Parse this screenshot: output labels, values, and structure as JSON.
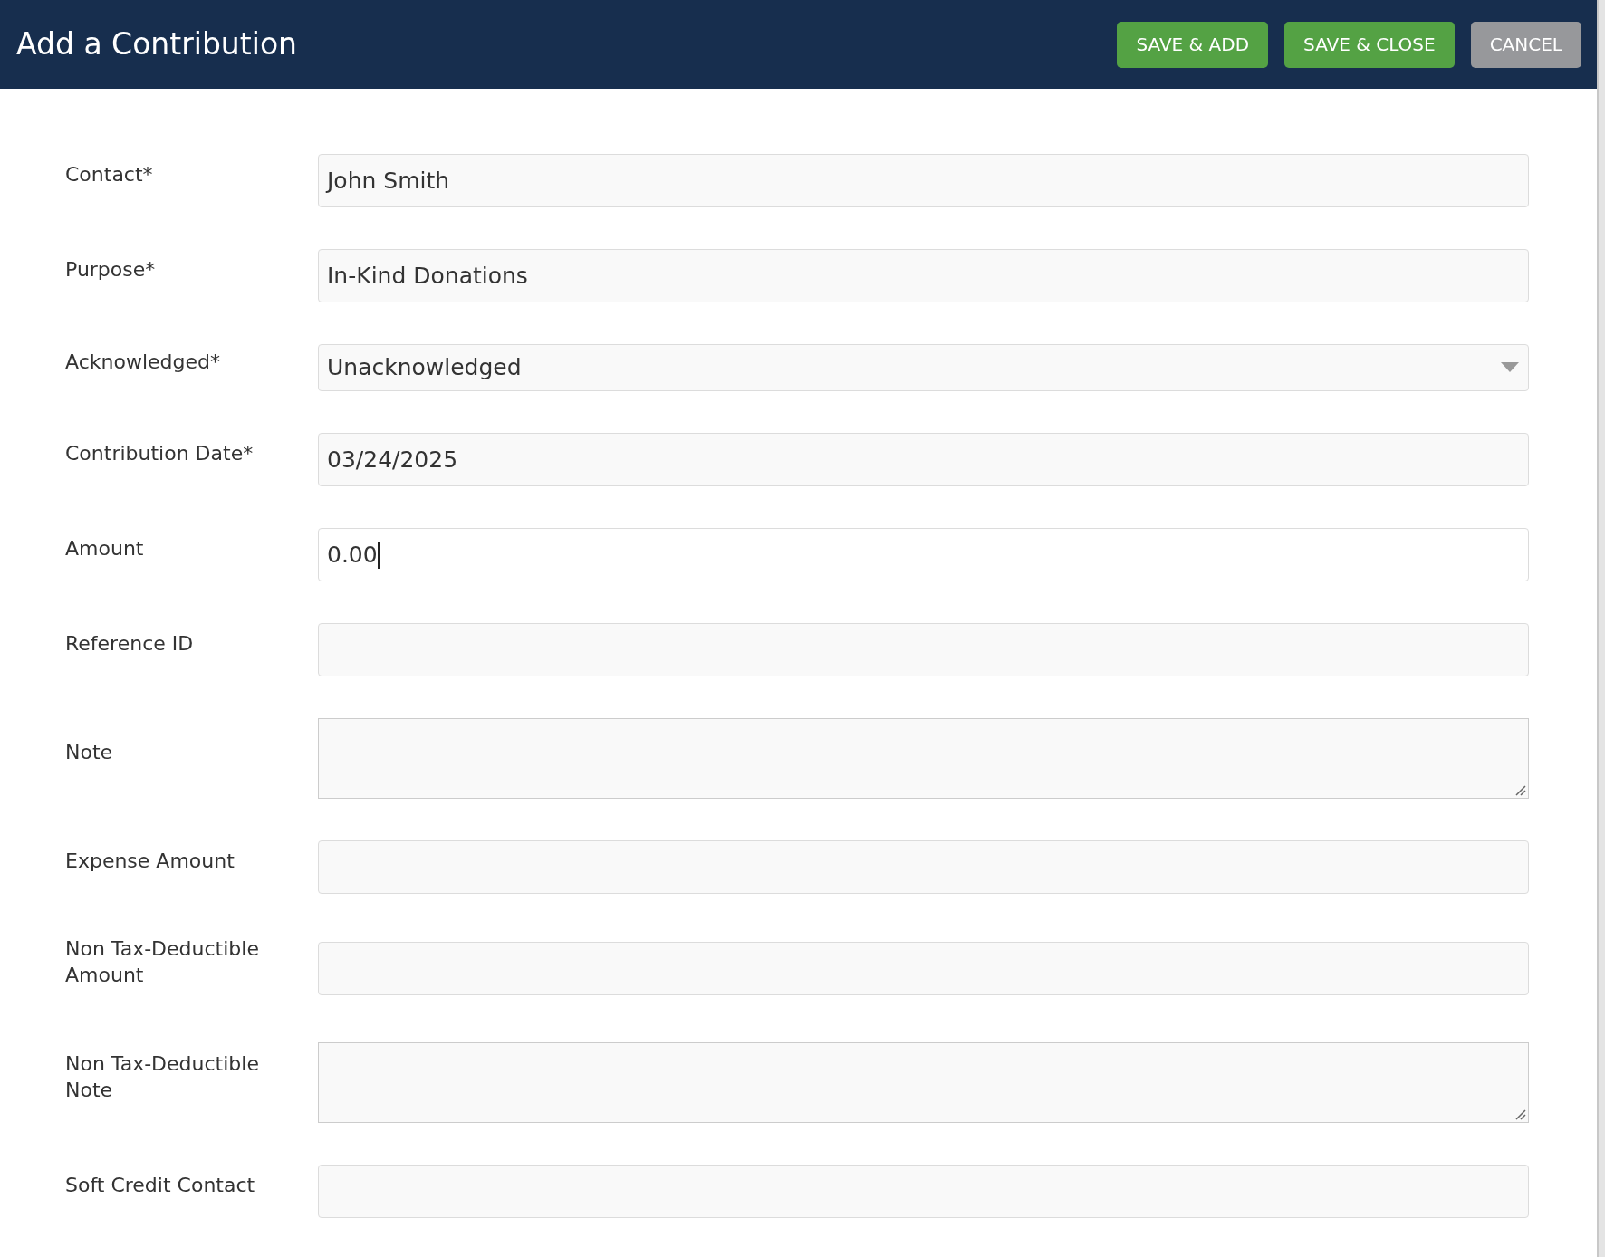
{
  "header": {
    "title": "Add a Contribution",
    "buttons": [
      {
        "label": "SAVE & ADD",
        "kind": "primary"
      },
      {
        "label": "SAVE & CLOSE",
        "kind": "primary"
      },
      {
        "label": "CANCEL",
        "kind": "secondary"
      }
    ]
  },
  "fields": [
    {
      "label": "Contact*",
      "kind": "input",
      "value": "John Smith",
      "focused": false
    },
    {
      "label": "Purpose*",
      "kind": "input",
      "value": "In-Kind Donations",
      "focused": false
    },
    {
      "label": "Acknowledged*",
      "kind": "select",
      "value": "Unacknowledged",
      "focused": false
    },
    {
      "label": "Contribution Date*",
      "kind": "input",
      "value": "03/24/2025",
      "focused": false
    },
    {
      "label": "Amount",
      "kind": "input",
      "value": "0.00",
      "focused": true
    },
    {
      "label": "Reference ID",
      "kind": "input",
      "focused": false
    },
    {
      "label": "Note",
      "kind": "textarea",
      "focused": false
    },
    {
      "label": "Expense Amount",
      "kind": "input",
      "focused": false
    },
    {
      "label": "Non Tax-Deductible Amount",
      "kind": "input",
      "focused": false
    },
    {
      "label": "Non Tax-Deductible Note",
      "kind": "textarea",
      "focused": false
    },
    {
      "label": "Soft Credit Contact",
      "kind": "input",
      "focused": false
    }
  ]
}
